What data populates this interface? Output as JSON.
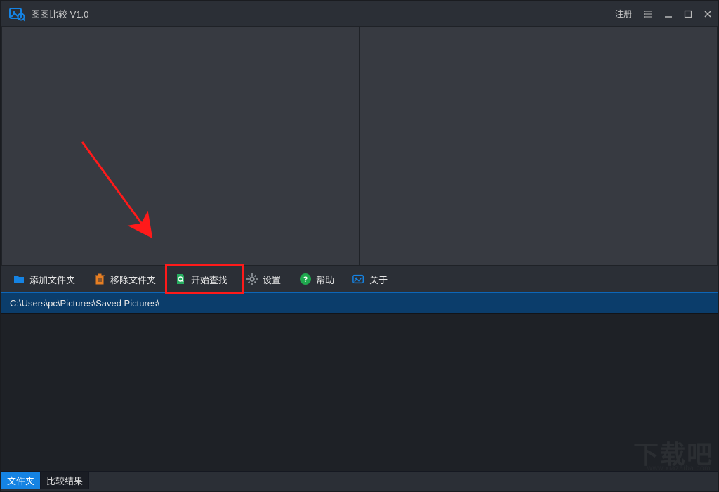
{
  "titlebar": {
    "app_title": "图图比较 V1.0",
    "register_label": "注册"
  },
  "toolbar": {
    "add_folder_label": "添加文件夹",
    "remove_folder_label": "移除文件夹",
    "start_search_label": "开始查找",
    "settings_label": "设置",
    "help_label": "帮助",
    "about_label": "关于"
  },
  "pathbar": {
    "path": "C:\\Users\\pc\\Pictures\\Saved Pictures\\"
  },
  "tabs": {
    "folders_label": "文件夹",
    "results_label": "比较结果"
  },
  "watermark": {
    "text": "下载吧",
    "subtext": "www.xiazaiba.com"
  },
  "colors": {
    "accent": "#1583e3",
    "path_bg": "#0b3d6b",
    "highlight": "#ff1a1a",
    "folder_icon": "#1583e3",
    "delete_icon": "#e67e22",
    "search_icon_bg": "#27ae60",
    "help_icon": "#1fa84e",
    "about_icon": "#1583e3"
  }
}
